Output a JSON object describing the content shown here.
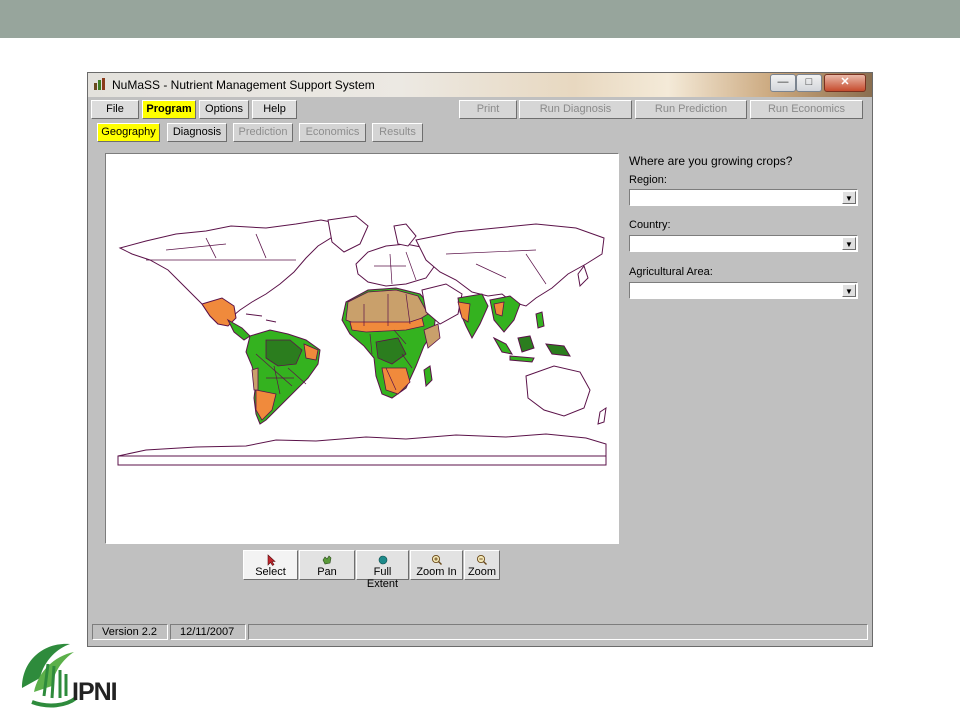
{
  "window": {
    "title": "NuMaSS - Nutrient Management Support System",
    "controls": {
      "minimize": "—",
      "maximize": "□",
      "close": "✕"
    }
  },
  "menu": [
    {
      "label": "File",
      "active": false
    },
    {
      "label": "Program",
      "active": true
    },
    {
      "label": "Options",
      "active": false
    },
    {
      "label": "Help",
      "active": false
    }
  ],
  "run_buttons": [
    {
      "label": "Print",
      "enabled": false
    },
    {
      "label": "Run Diagnosis",
      "enabled": false
    },
    {
      "label": "Run Prediction",
      "enabled": false
    },
    {
      "label": "Run Economics",
      "enabled": false
    }
  ],
  "tabs": [
    {
      "label": "Geography",
      "state": "active"
    },
    {
      "label": "Diagnosis",
      "state": "enabled"
    },
    {
      "label": "Prediction",
      "state": "disabled"
    },
    {
      "label": "Economics",
      "state": "disabled"
    },
    {
      "label": "Results",
      "state": "disabled"
    }
  ],
  "map": {
    "legend_colors": {
      "tan": "#c9a06b",
      "orange": "#f08a3c",
      "green": "#34b21f",
      "dark_green": "#2b7d1e",
      "outline": "#5b1249"
    }
  },
  "form": {
    "question": "Where are you growing crops?",
    "region": {
      "label": "Region:",
      "value": ""
    },
    "country": {
      "label": "Country:",
      "value": ""
    },
    "agricultural_area": {
      "label": "Agricultural Area:",
      "value": ""
    }
  },
  "tools": [
    {
      "label": "Select",
      "icon": "cursor-arrow-icon",
      "selected": true
    },
    {
      "label": "Pan",
      "icon": "hand-pan-icon",
      "selected": false
    },
    {
      "label": "Full Extent",
      "icon": "globe-icon",
      "selected": false
    },
    {
      "label": "Zoom In",
      "icon": "zoom-in-icon",
      "selected": false
    },
    {
      "label": "Zoom",
      "icon": "zoom-out-icon",
      "selected": false
    }
  ],
  "status": {
    "version": "Version 2.2",
    "date": "12/11/2007"
  },
  "logo": {
    "text": "IPNI"
  }
}
